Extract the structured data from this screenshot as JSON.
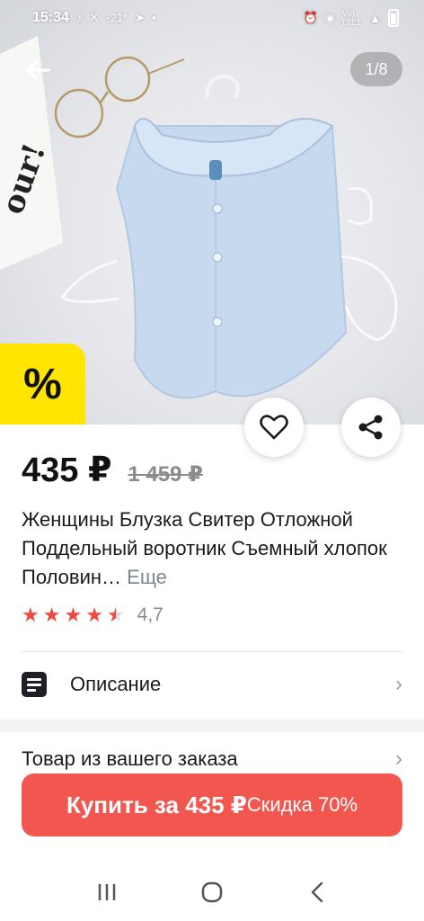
{
  "status": {
    "time": "15:34",
    "temp": "-21°",
    "network": "Vo) LTE1"
  },
  "gallery": {
    "counter": "1/8",
    "sale_badge": "%"
  },
  "product": {
    "price": "435 ₽",
    "old_price": "1 459 ₽",
    "title": "Женщины Блузка Свитер Отложной Поддельный воротник Съемный хлопок Половин…",
    "more_label": "Еще",
    "rating": "4,7",
    "rating_stars": 4.7
  },
  "sections": {
    "description": "Описание",
    "order_item": "Товар из вашего заказа"
  },
  "buy": {
    "label": "Купить за 435 ₽",
    "discount": "Скидка 70%"
  },
  "colors": {
    "accent": "#f2574f",
    "badge": "#ffe500",
    "star": "#f0473f"
  }
}
